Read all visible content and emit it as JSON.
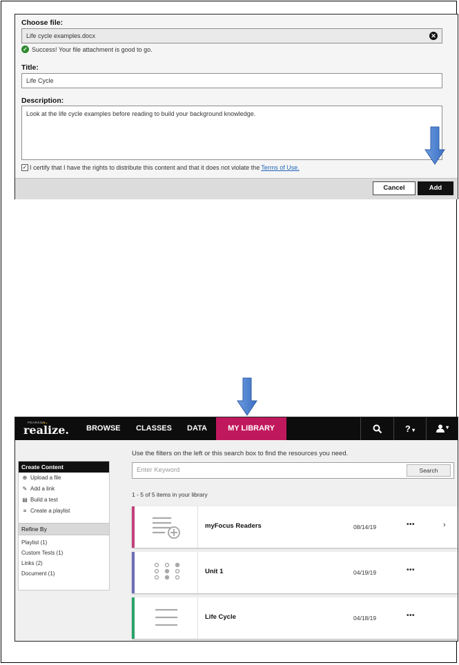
{
  "dialog": {
    "choose_file_label": "Choose file:",
    "file_value": "Life cycle examples.docx",
    "success_message": "Success! Your file attachment is good to go.",
    "title_label": "Title:",
    "title_value": "Life Cycle",
    "description_label": "Description:",
    "description_value": "Look at the life cycle examples before reading to build your background knowledge.",
    "certify_text": "I certify that I have the rights to distribute this content and that it does not violate the",
    "terms_link": "Terms of Use.",
    "certified": true,
    "cancel_label": "Cancel",
    "add_label": "Add"
  },
  "realize": {
    "logo_pearson": "PEARSON",
    "logo_text": "realize.",
    "nav": [
      "BROWSE",
      "CLASSES",
      "DATA",
      "MY LIBRARY"
    ],
    "active_nav": "MY LIBRARY",
    "create_content": {
      "heading": "Create Content",
      "items": [
        {
          "icon": "upload-icon",
          "label": "Upload a file"
        },
        {
          "icon": "link-icon",
          "label": "Add a link"
        },
        {
          "icon": "test-icon",
          "label": "Build a test"
        },
        {
          "icon": "playlist-icon",
          "label": "Create a playlist"
        }
      ]
    },
    "refine": {
      "heading": "Refine By",
      "items": [
        "Playlist (1)",
        "Custom Tests (1)",
        "Links (2)",
        "Document (1)"
      ]
    },
    "hint": "Use the filters on the left or this search box to find the resources you need.",
    "search_placeholder": "Enter Keyword",
    "search_button": "Search",
    "count_text": "1 - 5 of 5 items in your library",
    "items": [
      {
        "name": "myFocus Readers",
        "date": "08/14/19",
        "more": "•••",
        "chevron": "›",
        "accent": "#c2417c",
        "icon": "playlist-icon"
      },
      {
        "name": "Unit 1",
        "date": "04/19/19",
        "more": "•••",
        "accent": "#6d6db8",
        "icon": "test-icon"
      },
      {
        "name": "Life Cycle",
        "date": "04/18/19",
        "more": "•••",
        "accent": "#2aa36b",
        "icon": "document-icon"
      }
    ]
  },
  "colors": {
    "nav_active": "#c0185c",
    "arrow": "#4a7fcf",
    "link": "#1f64b5"
  }
}
